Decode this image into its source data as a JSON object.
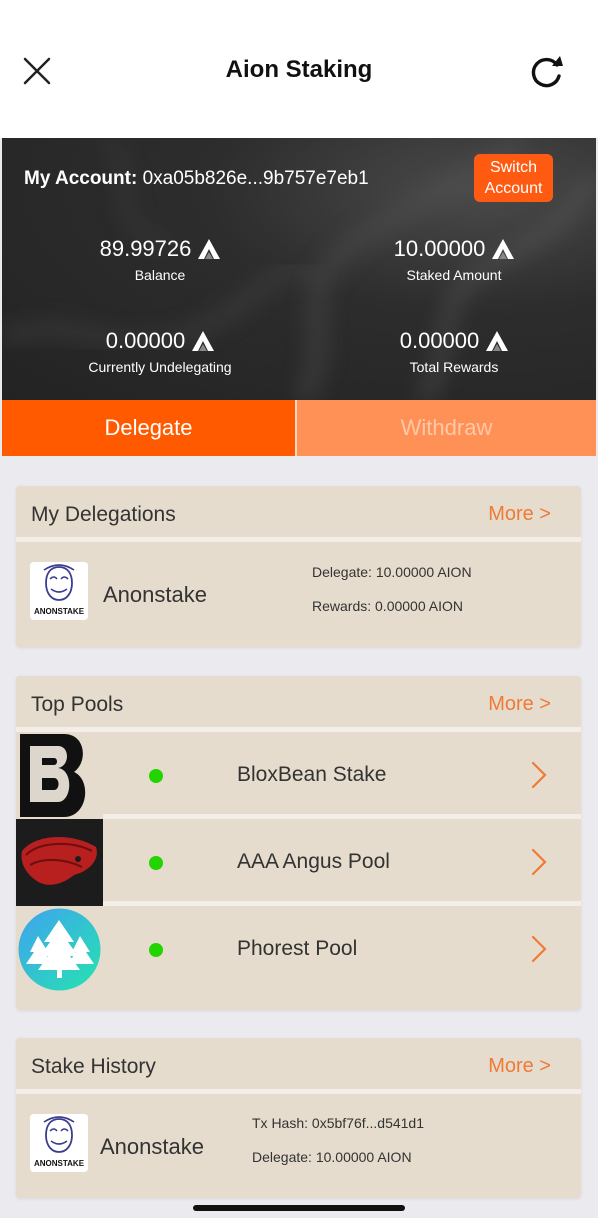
{
  "header": {
    "title": "Aion Staking",
    "close_icon": "close-icon",
    "refresh_icon": "refresh-icon"
  },
  "account": {
    "label": "My Account:",
    "address": "0xa05b826e...9b757e7eb1",
    "switch_label_1": "Switch",
    "switch_label_2": "Account",
    "stats": [
      {
        "value": "89.99726",
        "caption": "Balance"
      },
      {
        "value": "10.00000",
        "caption": "Staked Amount"
      },
      {
        "value": "0.00000",
        "caption": "Currently Undelegating"
      },
      {
        "value": "0.00000",
        "caption": "Total Rewards"
      }
    ]
  },
  "tabs": {
    "delegate": "Delegate",
    "withdraw": "Withdraw"
  },
  "delegations": {
    "title": "My Delegations",
    "more": "More >",
    "item": {
      "logo_text": "ANONSTAKE",
      "name": "Anonstake",
      "delegate": "Delegate: 10.00000 AION",
      "rewards": "Rewards: 0.00000 AION"
    }
  },
  "pools": {
    "title": "Top Pools",
    "more": "More >",
    "items": [
      {
        "name": "BloxBean Stake",
        "status_color": "#22d400"
      },
      {
        "name": "AAA Angus Pool",
        "status_color": "#22d400"
      },
      {
        "name": "Phorest Pool",
        "status_color": "#22d400"
      }
    ]
  },
  "history": {
    "title": "Stake History",
    "more": "More >",
    "item": {
      "logo_text": "ANONSTAKE",
      "name": "Anonstake",
      "tx_hash": "Tx Hash: 0x5bf76f...d541d1",
      "delegate": "Delegate: 10.00000 AION"
    }
  },
  "colors": {
    "accent": "#ff5a00",
    "accent_light": "#ff9157",
    "card_bg": "#e5dccd",
    "more_link": "#f07a36"
  }
}
